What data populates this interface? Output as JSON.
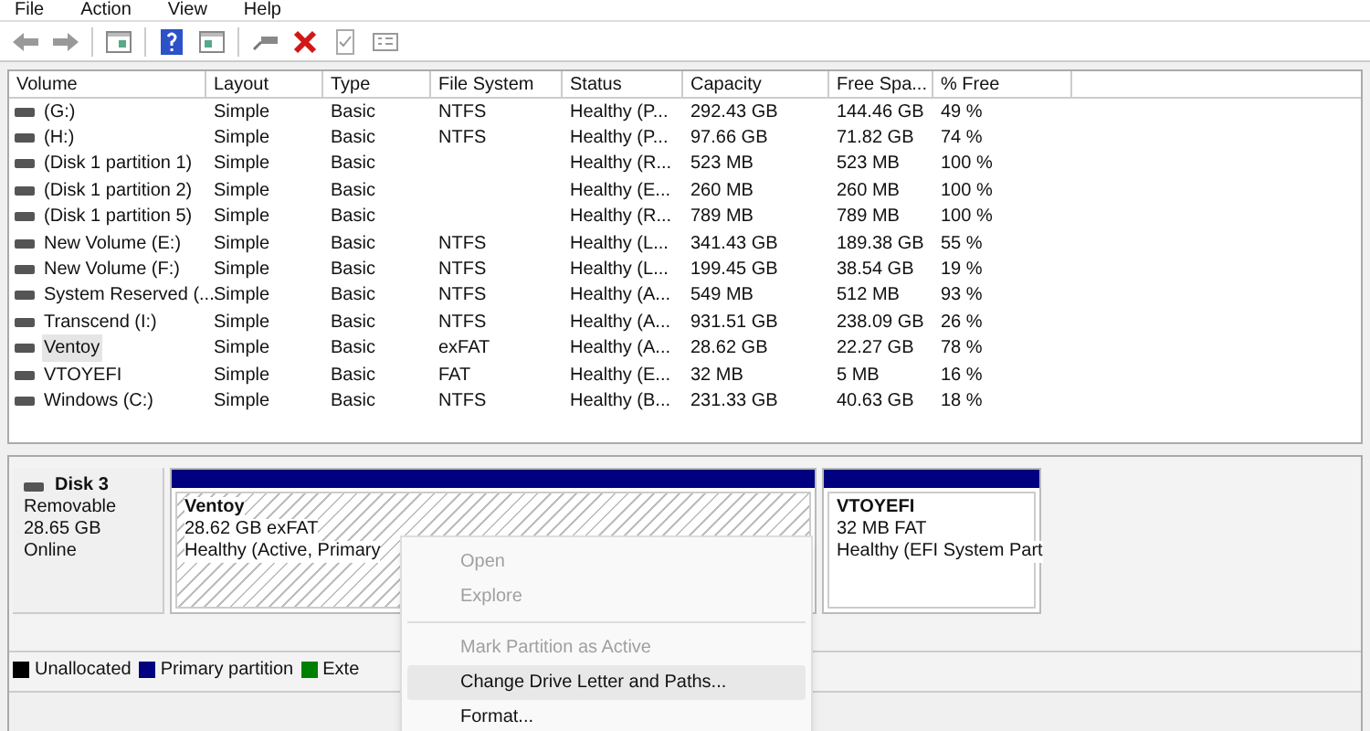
{
  "menu_bar": [
    "File",
    "Action",
    "View",
    "Help"
  ],
  "table": {
    "columns": [
      "Volume",
      "Layout",
      "Type",
      "File System",
      "Status",
      "Capacity",
      "Free Spa...",
      "% Free"
    ],
    "rows": [
      {
        "selected": false,
        "cells": [
          "(G:)",
          "Simple",
          "Basic",
          "NTFS",
          "Healthy (P...",
          "292.43 GB",
          "144.46 GB",
          "49 %"
        ]
      },
      {
        "selected": false,
        "cells": [
          "(H:)",
          "Simple",
          "Basic",
          "NTFS",
          "Healthy (P...",
          "97.66 GB",
          "71.82 GB",
          "74 %"
        ]
      },
      {
        "selected": false,
        "cells": [
          "(Disk 1 partition 1)",
          "Simple",
          "Basic",
          "",
          "Healthy (R...",
          "523 MB",
          "523 MB",
          "100 %"
        ]
      },
      {
        "selected": false,
        "cells": [
          "(Disk 1 partition 2)",
          "Simple",
          "Basic",
          "",
          "Healthy (E...",
          "260 MB",
          "260 MB",
          "100 %"
        ]
      },
      {
        "selected": false,
        "cells": [
          "(Disk 1 partition 5)",
          "Simple",
          "Basic",
          "",
          "Healthy (R...",
          "789 MB",
          "789 MB",
          "100 %"
        ]
      },
      {
        "selected": false,
        "cells": [
          "New Volume (E:)",
          "Simple",
          "Basic",
          "NTFS",
          "Healthy (L...",
          "341.43 GB",
          "189.38 GB",
          "55 %"
        ]
      },
      {
        "selected": false,
        "cells": [
          "New Volume (F:)",
          "Simple",
          "Basic",
          "NTFS",
          "Healthy (L...",
          "199.45 GB",
          "38.54 GB",
          "19 %"
        ]
      },
      {
        "selected": false,
        "cells": [
          "System Reserved (...",
          "Simple",
          "Basic",
          "NTFS",
          "Healthy (A...",
          "549 MB",
          "512 MB",
          "93 %"
        ]
      },
      {
        "selected": false,
        "cells": [
          "Transcend (I:)",
          "Simple",
          "Basic",
          "NTFS",
          "Healthy (A...",
          "931.51 GB",
          "238.09 GB",
          "26 %"
        ]
      },
      {
        "selected": true,
        "cells": [
          "Ventoy",
          "Simple",
          "Basic",
          "exFAT",
          "Healthy (A...",
          "28.62 GB",
          "22.27 GB",
          "78 %"
        ]
      },
      {
        "selected": false,
        "cells": [
          "VTOYEFI",
          "Simple",
          "Basic",
          "FAT",
          "Healthy (E...",
          "32 MB",
          "5 MB",
          "16 %"
        ]
      },
      {
        "selected": false,
        "cells": [
          "Windows (C:)",
          "Simple",
          "Basic",
          "NTFS",
          "Healthy (B...",
          "231.33 GB",
          "40.63 GB",
          "18 %"
        ]
      }
    ]
  },
  "disk": {
    "name": "Disk 3",
    "type": "Removable",
    "size": "28.65 GB",
    "status": "Online",
    "partitions": [
      {
        "name": "Ventoy",
        "size": "28.62 GB exFAT",
        "status": "Healthy (Active, Primary",
        "selected": true
      },
      {
        "name": "VTOYEFI",
        "size": "32 MB FAT",
        "status": "Healthy (EFI System Part",
        "selected": false
      }
    ]
  },
  "legend": [
    {
      "label": "Unallocated",
      "color": "#000000"
    },
    {
      "label": "Primary partition",
      "color": "#000080"
    },
    {
      "label": "Exte",
      "color": "#008000"
    }
  ],
  "context_menu": [
    {
      "kind": "item",
      "label": "Open",
      "disabled": true,
      "selected": false
    },
    {
      "kind": "item",
      "label": "Explore",
      "disabled": true,
      "selected": false
    },
    {
      "kind": "separator"
    },
    {
      "kind": "item",
      "label": "Mark Partition as Active",
      "disabled": true,
      "selected": false
    },
    {
      "kind": "item",
      "label": "Change Drive Letter and Paths...",
      "disabled": false,
      "selected": true
    },
    {
      "kind": "item",
      "label": "Format...",
      "disabled": false,
      "selected": false
    }
  ]
}
